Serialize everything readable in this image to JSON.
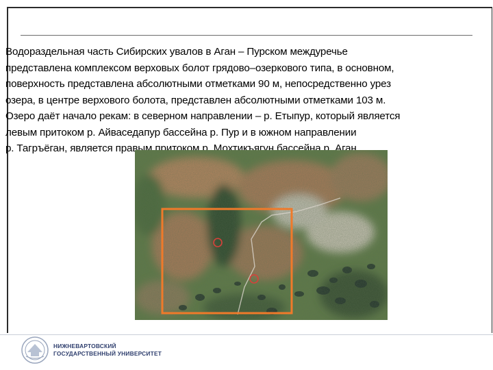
{
  "slide": {
    "paragraph_lines": [
      "Водораздельная часть Сибирских увалов в Аган – Пурском междуречье",
      "представлена комплексом верховых болот грядово–озеркового типа, в основном,",
      "поверхность представлена абсолютными отметками 90 м, непосредственно урез",
      "озера, в центре верхового болота, представлен абсолютными отметками 103 м.",
      "Озеро даёт начало рекам: в северном направлении – р. Етыпур, который является",
      "левым притоком р. Айваседапур бассейна р. Пур и в южном направлении",
      "р. Тагръёган, является правым притоком р. Мохтикъягун бассейна р. Аган."
    ]
  },
  "footer": {
    "university_line1": "НИЖНЕВАРТОВСКИЙ",
    "university_line2": "ГОСУДАРСТВЕННЫЙ УНИВЕРСИТЕТ",
    "logo_icon": "university-emblem-icon"
  },
  "colors": {
    "frame": "#2b2b2b",
    "highlight_box": "#f07a2a",
    "marker": "#d8413a",
    "footer_text": "#2f3f6e"
  }
}
